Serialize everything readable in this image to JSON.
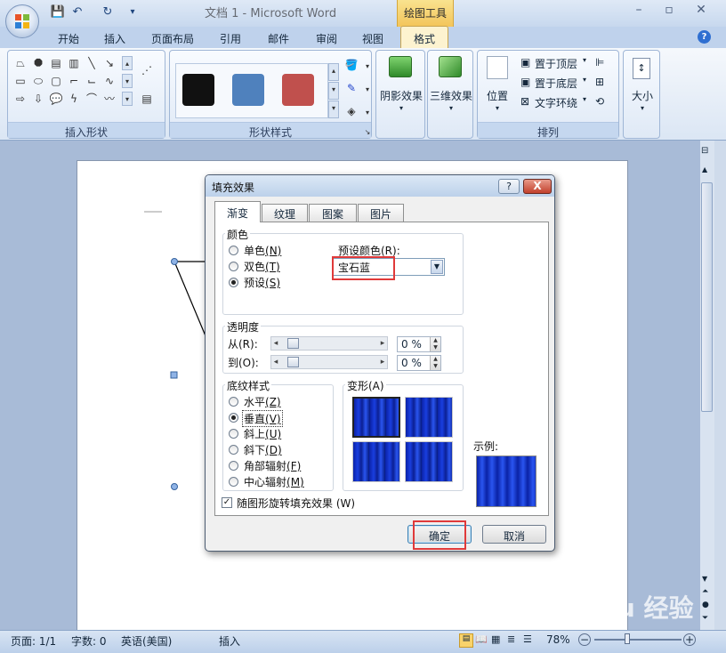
{
  "window": {
    "title": "文档 1 - Microsoft Word",
    "context_tab_group": "绘图工具",
    "minimize_icon": "minimize-icon",
    "maximize_icon": "maximize-icon",
    "close_icon": "close-icon"
  },
  "tabs": [
    "开始",
    "插入",
    "页面布局",
    "引用",
    "邮件",
    "审阅",
    "视图",
    "格式"
  ],
  "active_tab": "格式",
  "ribbon": {
    "insert_shapes_label": "插入形状",
    "shape_styles_label": "形状样式",
    "shadow_effects": "阴影效果",
    "three_d_effects": "三维效果",
    "position": "位置",
    "bring_to_front": "置于顶层",
    "send_to_back": "置于底层",
    "text_wrapping": "文字环绕",
    "arrange_label": "排列",
    "size": "大小",
    "swatch_colors": [
      "#111111",
      "#4f81bd",
      "#c0504d"
    ]
  },
  "dialog": {
    "title": "填充效果",
    "help": "?",
    "close": "X",
    "tabs": [
      "渐变",
      "纹理",
      "图案",
      "图片"
    ],
    "active_tab": "渐变",
    "colors_section": "颜色",
    "color_options": [
      {
        "label": "单色",
        "key": "(N)",
        "checked": false
      },
      {
        "label": "双色",
        "key": "(T)",
        "checked": false
      },
      {
        "label": "预设",
        "key": "(S)",
        "checked": true
      }
    ],
    "preset_colors_label": "预设颜色(R):",
    "preset_value": "宝石蓝",
    "transparency_section": "透明度",
    "from_label": "从(R):",
    "to_label": "到(O):",
    "from_value": "0 %",
    "to_value": "0 %",
    "shading_section": "底纹样式",
    "shading_options": [
      {
        "label": "水平",
        "key": "(Z)",
        "checked": false
      },
      {
        "label": "垂直",
        "key": "(V)",
        "checked": true
      },
      {
        "label": "斜上",
        "key": "(U)",
        "checked": false
      },
      {
        "label": "斜下",
        "key": "(D)",
        "checked": false
      },
      {
        "label": "角部辐射",
        "key": "(F)",
        "checked": false
      },
      {
        "label": "中心辐射",
        "key": "(M)",
        "checked": false
      }
    ],
    "variants_label": "变形(A)",
    "sample_label": "示例:",
    "rotate_checkbox": "随图形旋转填充效果 (W)",
    "rotate_checked": true,
    "ok": "确定",
    "cancel": "取消",
    "sample_colors": [
      "#0a22a6",
      "#2a55f0"
    ]
  },
  "status": {
    "page": "页面: 1/1",
    "words": "字数: 0",
    "language": "英语(美国)",
    "mode": "插入",
    "zoom": "78%"
  },
  "watermark": "Baidu 经验"
}
